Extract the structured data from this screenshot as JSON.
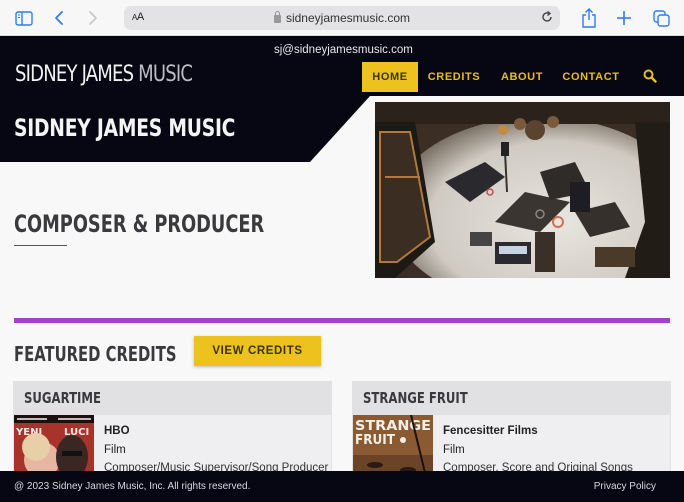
{
  "browser": {
    "url": "sidneyjamesmusic.com",
    "text_size_label_small": "A",
    "text_size_label_large": "A",
    "icons": [
      "sidebar-icon",
      "back-icon",
      "forward-icon",
      "lock-icon",
      "reload-icon",
      "share-icon",
      "new-tab-icon",
      "tabs-icon"
    ],
    "accent_color": "#2f7cf6"
  },
  "header": {
    "email": "sj@sidneyjamesmusic.com",
    "logo": {
      "part1": "SIDNEY JAMES",
      "part2": "MUSIC"
    },
    "nav": [
      {
        "label": "HOME",
        "active": true
      },
      {
        "label": "CREDITS",
        "active": false
      },
      {
        "label": "ABOUT",
        "active": false
      },
      {
        "label": "CONTACT",
        "active": false
      }
    ],
    "search_icon": "search-icon",
    "accent_color": "#edc21f"
  },
  "hero": {
    "title": "SIDNEY JAMES MUSIC",
    "subtitle": "COMPOSER & PRODUCER",
    "image_alt": "Recording studio overhead view"
  },
  "featured": {
    "title": "FEATURED CREDITS",
    "button_label": "VIEW CREDITS",
    "divider_color": "#a543c5",
    "credits": [
      {
        "title": "SUGARTIME",
        "company": "HBO",
        "type": "Film",
        "role": "Composer/Music Supervisor/Song Producer",
        "poster_text": "YENI E LUCI"
      },
      {
        "title": "STRANGE FRUIT",
        "company": "Fencesitter Films",
        "type": "Film",
        "role": "Composer, Score and Original Songs",
        "poster_text": "STRANGE FRUIT"
      }
    ]
  },
  "footer": {
    "copyright": "@ 2023 Sidney James Music, Inc. All rights reserved.",
    "privacy_link": "Privacy Policy"
  }
}
